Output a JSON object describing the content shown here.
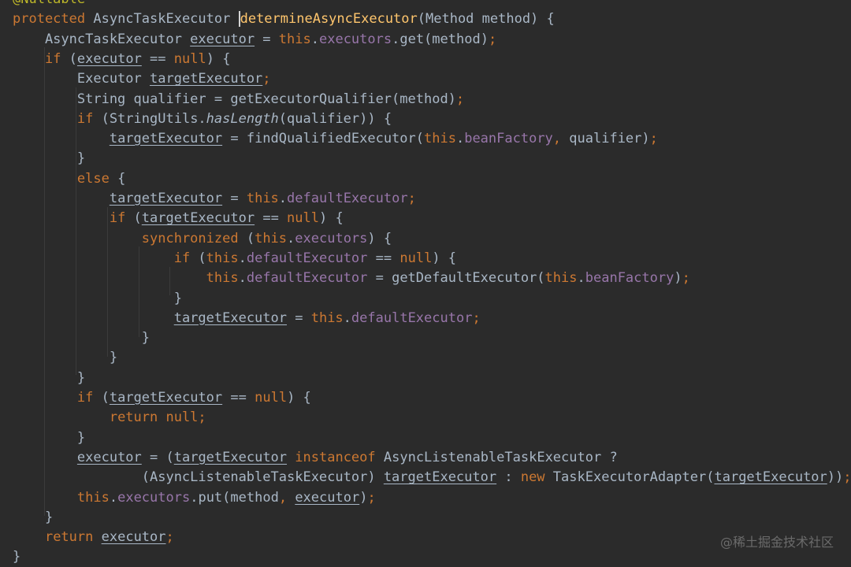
{
  "watermark": "@稀土掘金技术社区",
  "colors": {
    "background": "#2b2b2b",
    "default_text": "#a9b7c6",
    "keyword": "#cc7832",
    "field": "#9876aa",
    "method_declaration": "#ffc66d",
    "annotation": "#bbb529"
  },
  "code_lines": [
    [
      [
        "@Nullable",
        "ann"
      ]
    ],
    [
      [
        "protected",
        "kw"
      ],
      [
        " AsyncTaskExecutor ",
        ""
      ],
      [
        "determineAsyncExecutor",
        "fn cur"
      ],
      [
        "(Method method) {",
        ""
      ]
    ],
    [
      [
        "    AsyncTaskExecutor ",
        ""
      ],
      [
        "executor",
        "var"
      ],
      [
        " = ",
        ""
      ],
      [
        "this",
        "kw"
      ],
      [
        ".",
        ""
      ],
      [
        "executors",
        "fld"
      ],
      [
        ".get(method)",
        ""
      ],
      [
        ";",
        "kw"
      ]
    ],
    [
      [
        "    ",
        ""
      ],
      [
        "if",
        "kw"
      ],
      [
        " (",
        ""
      ],
      [
        "executor",
        "var"
      ],
      [
        " == ",
        ""
      ],
      [
        "null",
        "kw"
      ],
      [
        ") {",
        ""
      ]
    ],
    [
      [
        "        Executor ",
        ""
      ],
      [
        "targetExecutor",
        "var"
      ],
      [
        ";",
        "kw"
      ]
    ],
    [
      [
        "        String qualifier = getExecutorQualifier(method)",
        ""
      ],
      [
        ";",
        "kw"
      ]
    ],
    [
      [
        "        ",
        ""
      ],
      [
        "if",
        "kw"
      ],
      [
        " (StringUtils.",
        ""
      ],
      [
        "hasLength",
        "it"
      ],
      [
        "(qualifier)) {",
        ""
      ]
    ],
    [
      [
        "            ",
        ""
      ],
      [
        "targetExecutor",
        "var"
      ],
      [
        " = findQualifiedExecutor(",
        ""
      ],
      [
        "this",
        "kw"
      ],
      [
        ".",
        ""
      ],
      [
        "beanFactory",
        "fld"
      ],
      [
        ",",
        "kw"
      ],
      [
        " qualifier)",
        ""
      ],
      [
        ";",
        "kw"
      ]
    ],
    [
      [
        "        }",
        ""
      ]
    ],
    [
      [
        "        ",
        ""
      ],
      [
        "else",
        "kw"
      ],
      [
        " {",
        ""
      ]
    ],
    [
      [
        "            ",
        ""
      ],
      [
        "targetExecutor",
        "var"
      ],
      [
        " = ",
        ""
      ],
      [
        "this",
        "kw"
      ],
      [
        ".",
        ""
      ],
      [
        "defaultExecutor",
        "fld"
      ],
      [
        ";",
        "kw"
      ]
    ],
    [
      [
        "            ",
        ""
      ],
      [
        "if",
        "kw"
      ],
      [
        " (",
        ""
      ],
      [
        "targetExecutor",
        "var"
      ],
      [
        " == ",
        ""
      ],
      [
        "null",
        "kw"
      ],
      [
        ") {",
        ""
      ]
    ],
    [
      [
        "                ",
        ""
      ],
      [
        "synchronized",
        "kw"
      ],
      [
        " (",
        ""
      ],
      [
        "this",
        "kw"
      ],
      [
        ".",
        ""
      ],
      [
        "executors",
        "fld"
      ],
      [
        ") {",
        ""
      ]
    ],
    [
      [
        "                    ",
        ""
      ],
      [
        "if",
        "kw"
      ],
      [
        " (",
        ""
      ],
      [
        "this",
        "kw"
      ],
      [
        ".",
        ""
      ],
      [
        "defaultExecutor",
        "fld"
      ],
      [
        " == ",
        ""
      ],
      [
        "null",
        "kw"
      ],
      [
        ") {",
        ""
      ]
    ],
    [
      [
        "                        ",
        ""
      ],
      [
        "this",
        "kw"
      ],
      [
        ".",
        ""
      ],
      [
        "defaultExecutor",
        "fld"
      ],
      [
        " = getDefaultExecutor(",
        ""
      ],
      [
        "this",
        "kw"
      ],
      [
        ".",
        ""
      ],
      [
        "beanFactory",
        "fld"
      ],
      [
        ")",
        ""
      ],
      [
        ";",
        "kw"
      ]
    ],
    [
      [
        "                    }",
        ""
      ]
    ],
    [
      [
        "                    ",
        ""
      ],
      [
        "targetExecutor",
        "var"
      ],
      [
        " = ",
        ""
      ],
      [
        "this",
        "kw"
      ],
      [
        ".",
        ""
      ],
      [
        "defaultExecutor",
        "fld"
      ],
      [
        ";",
        "kw"
      ]
    ],
    [
      [
        "                }",
        ""
      ]
    ],
    [
      [
        "            }",
        ""
      ]
    ],
    [
      [
        "        }",
        ""
      ]
    ],
    [
      [
        "        ",
        ""
      ],
      [
        "if",
        "kw"
      ],
      [
        " (",
        ""
      ],
      [
        "targetExecutor",
        "var"
      ],
      [
        " == ",
        ""
      ],
      [
        "null",
        "kw"
      ],
      [
        ") {",
        ""
      ]
    ],
    [
      [
        "            ",
        ""
      ],
      [
        "return null",
        "kw"
      ],
      [
        ";",
        "kw"
      ]
    ],
    [
      [
        "        }",
        ""
      ]
    ],
    [
      [
        "        ",
        ""
      ],
      [
        "executor",
        "var"
      ],
      [
        " = (",
        ""
      ],
      [
        "targetExecutor",
        "var"
      ],
      [
        " ",
        ""
      ],
      [
        "instanceof",
        "kw"
      ],
      [
        " AsyncListenableTaskExecutor ?",
        ""
      ]
    ],
    [
      [
        "                (AsyncListenableTaskExecutor) ",
        ""
      ],
      [
        "targetExecutor",
        "var"
      ],
      [
        " : ",
        ""
      ],
      [
        "new",
        "kw"
      ],
      [
        " TaskExecutorAdapter(",
        ""
      ],
      [
        "targetExecutor",
        "var"
      ],
      [
        "))",
        ""
      ],
      [
        ";",
        "kw"
      ]
    ],
    [
      [
        "        ",
        ""
      ],
      [
        "this",
        "kw"
      ],
      [
        ".",
        ""
      ],
      [
        "executors",
        "fld"
      ],
      [
        ".put(method",
        ""
      ],
      [
        ",",
        "kw"
      ],
      [
        " ",
        ""
      ],
      [
        "executor",
        "var"
      ],
      [
        ")",
        ""
      ],
      [
        ";",
        "kw"
      ]
    ],
    [
      [
        "    }",
        ""
      ]
    ],
    [
      [
        "    ",
        ""
      ],
      [
        "return",
        "kw"
      ],
      [
        " ",
        ""
      ],
      [
        "executor",
        "var"
      ],
      [
        ";",
        "kw"
      ]
    ],
    [
      [
        "}",
        ""
      ]
    ]
  ]
}
